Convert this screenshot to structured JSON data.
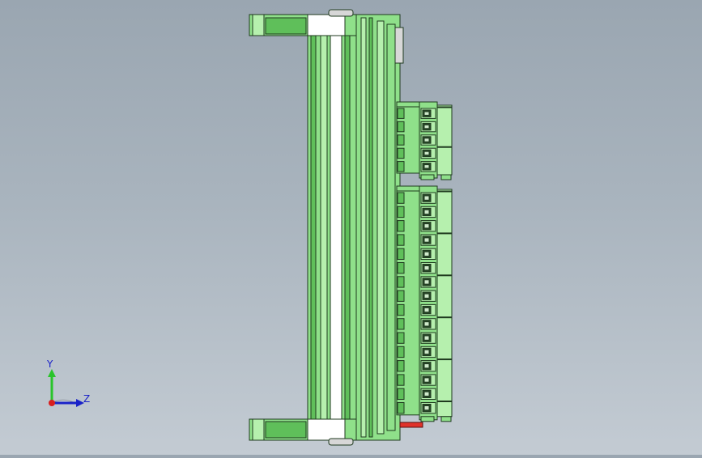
{
  "viewport": {
    "background_top": "#9aa6b1",
    "background_bottom": "#c3cbd3"
  },
  "model": {
    "part_color": "#8fe08a",
    "part_color_light": "#b6f0ae",
    "part_color_dark": "#5fbf5a",
    "edge_color": "#1f3a1f",
    "terminal_block_upper_count": 5,
    "terminal_block_lower_count": 16,
    "accent_pin_color": "#e0322a"
  },
  "triad": {
    "y_label": "Y",
    "z_label": "Z",
    "y_axis_color": "#29c42a",
    "z_axis_color": "#1a22c8",
    "x_origin_color": "#d81f1f"
  }
}
